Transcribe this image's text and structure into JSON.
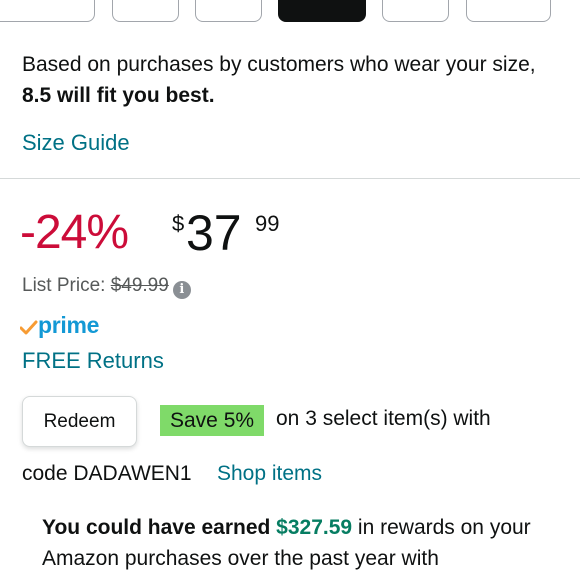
{
  "size_row": {
    "selected_index": 3
  },
  "fit": {
    "prefix": "Based on purchases by customers who wear your size, ",
    "recommendation": "8.5 will fit you best."
  },
  "size_guide_link": "Size Guide",
  "price": {
    "discount": "-24%",
    "currency_symbol": "$",
    "whole": "37",
    "fraction": "99"
  },
  "list_price": {
    "label": "List Price: ",
    "value": "$49.99"
  },
  "prime": {
    "label": "prime"
  },
  "free_returns_link": "FREE Returns",
  "coupon": {
    "redeem_label": "Redeem",
    "badge": "Save 5%",
    "tail": "on 3 select item(s) with",
    "code_text": "code DADAWEN1",
    "shop_link": "Shop items"
  },
  "rewards": {
    "lead": "You could have earned ",
    "amount": "$327.59",
    "tail": " in rewards on your Amazon purchases over the past year with"
  },
  "colors": {
    "discount": "#cc0c39",
    "link": "#007185",
    "prime_blue": "#1399d5",
    "prime_check": "#f79c34",
    "badge_green": "#7fda69",
    "reward_green": "#067d62"
  },
  "icons": {
    "info": "info-icon",
    "prime_check": "prime-check-icon"
  }
}
